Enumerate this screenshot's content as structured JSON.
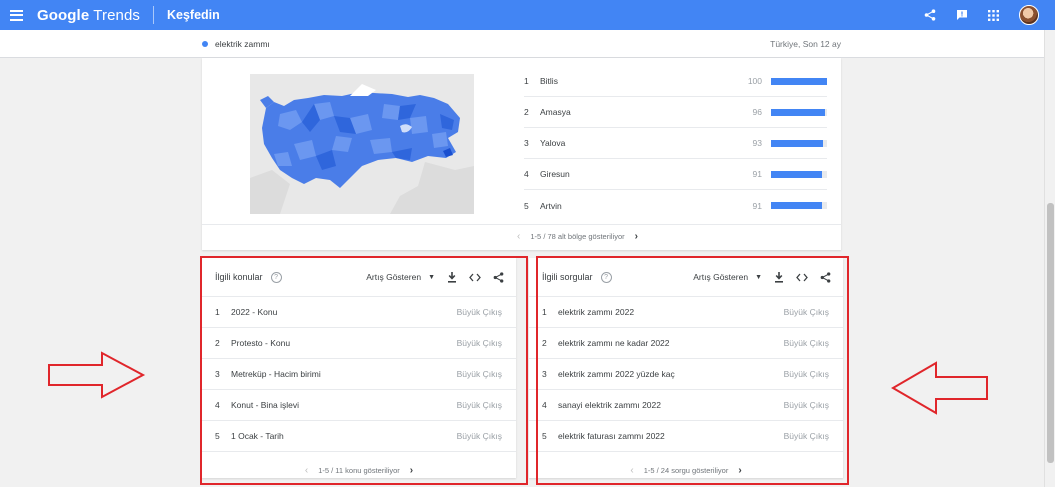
{
  "header": {
    "logo_bold": "Google",
    "logo_light": "Trends",
    "section": "Keşfedin",
    "icons": [
      "menu-icon",
      "share-icon",
      "feedback-icon",
      "apps-icon",
      "avatar"
    ]
  },
  "subbar": {
    "term": "elektrik zammı",
    "region_time": "Türkiye, Son 12 ay",
    "term_color": "#4285f4"
  },
  "regions": {
    "items": [
      {
        "rank": "1",
        "name": "Bitlis",
        "value": "100",
        "level": 1.0
      },
      {
        "rank": "2",
        "name": "Amasya",
        "value": "96",
        "level": 0.96
      },
      {
        "rank": "3",
        "name": "Yalova",
        "value": "93",
        "level": 0.93
      },
      {
        "rank": "4",
        "name": "Giresun",
        "value": "91",
        "level": 0.91
      },
      {
        "rank": "5",
        "name": "Artvin",
        "value": "91",
        "level": 0.91
      }
    ],
    "pager": "1-5 / 78 alt bölge gösteriliyor"
  },
  "related_topics": {
    "title": "İlgili konular",
    "sort": "Artış Gösteren",
    "items": [
      {
        "rank": "1",
        "text": "2022 - Konu",
        "badge": "Büyük Çıkış"
      },
      {
        "rank": "2",
        "text": "Protesto - Konu",
        "badge": "Büyük Çıkış"
      },
      {
        "rank": "3",
        "text": "Metreküp - Hacim birimi",
        "badge": "Büyük Çıkış"
      },
      {
        "rank": "4",
        "text": "Konut - Bina işlevi",
        "badge": "Büyük Çıkış"
      },
      {
        "rank": "5",
        "text": "1 Ocak - Tarih",
        "badge": "Büyük Çıkış"
      }
    ],
    "pager": "1-5 / 11 konu gösteriliyor"
  },
  "related_queries": {
    "title": "İlgili sorgular",
    "sort": "Artış Gösteren",
    "items": [
      {
        "rank": "1",
        "text": "elektrik zammı 2022",
        "badge": "Büyük Çıkış"
      },
      {
        "rank": "2",
        "text": "elektrik zammı ne kadar 2022",
        "badge": "Büyük Çıkış"
      },
      {
        "rank": "3",
        "text": "elektrik zammı 2022 yüzde kaç",
        "badge": "Büyük Çıkış"
      },
      {
        "rank": "4",
        "text": "sanayi elektrik zammı 2022",
        "badge": "Büyük Çıkış"
      },
      {
        "rank": "5",
        "text": "elektrik faturası zammı 2022",
        "badge": "Büyük Çıkış"
      }
    ],
    "pager": "1-5 / 24 sorgu gösteriliyor"
  },
  "colors": {
    "brand_blue": "#4285f4",
    "annotation_red": "#e0262b"
  }
}
